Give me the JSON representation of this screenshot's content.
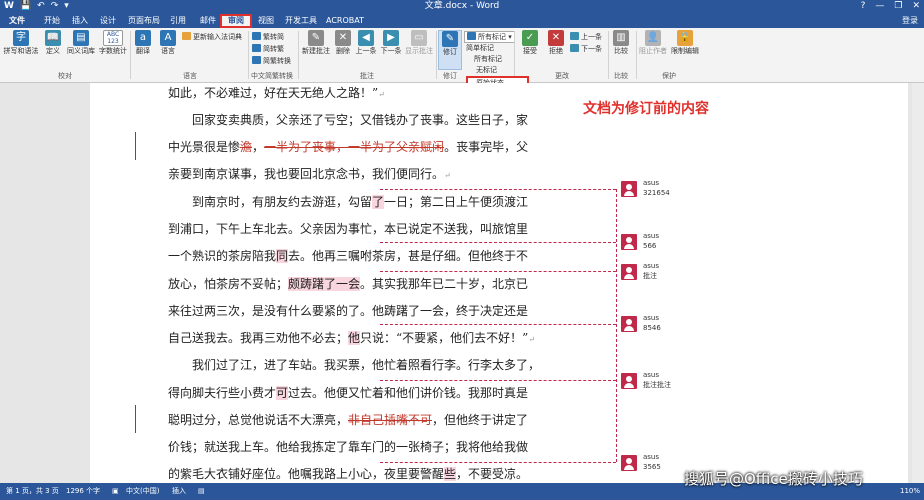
{
  "window": {
    "title": "文章.docx - Word",
    "login": "登录",
    "help": "?",
    "minimize": "—",
    "restore": "❐",
    "close": "✕"
  },
  "qat": {
    "save": "💾",
    "undo": "↶",
    "redo": "↷",
    "more": "▾"
  },
  "tabs": [
    {
      "label": "文件"
    },
    {
      "label": "开始"
    },
    {
      "label": "插入"
    },
    {
      "label": "设计"
    },
    {
      "label": "页面布局"
    },
    {
      "label": "引用"
    },
    {
      "label": "邮件"
    },
    {
      "label": "审阅"
    },
    {
      "label": "视图"
    },
    {
      "label": "开发工具"
    },
    {
      "label": "ACROBAT"
    }
  ],
  "ribbon": {
    "proofing": {
      "group": "校对",
      "spelling": "拼写和语法",
      "define": "定义",
      "thesaurus": "同义词库",
      "wordcount": "字数统计",
      "wordcount_icon": "ABC 123"
    },
    "language": {
      "group": "语言",
      "translate": "翻译",
      "language": "语言",
      "update_ime": "更新输入法词典"
    },
    "chinese": {
      "group": "中文简繁转换",
      "to_simplified": "繁转简",
      "to_traditional": "简转繁",
      "convert": "简繁转换"
    },
    "comments": {
      "group": "批注",
      "new": "新建批注",
      "delete": "删除",
      "previous": "上一条",
      "next": "下一条",
      "show": "显示批注"
    },
    "tracking": {
      "group": "修订",
      "track": "修订",
      "markup_all": "所有标记",
      "simple_markup": "简单标记",
      "all_markup": "所有标记",
      "no_markup": "无标记",
      "original": "原始状态",
      "pane_short": "修订"
    },
    "changes": {
      "group": "更改",
      "accept": "接受",
      "reject": "拒绝",
      "previous": "上一条",
      "next": "下一条"
    },
    "compare": {
      "group": "比较",
      "compare": "比较"
    },
    "protect": {
      "group": "保护",
      "block_authors": "阻止作者",
      "restrict": "限制编辑"
    }
  },
  "annotation": {
    "text": "文档为修订前的内容"
  },
  "document": {
    "lines": [
      {
        "segments": [
          {
            "t": "如此，不必难过，好在天无绝人之路！”",
            "k": "n"
          }
        ],
        "para_end": true
      },
      {
        "segments": [
          {
            "t": "　　回家变卖典质，父亲还了亏空；又借钱办了丧事。这些日子，家",
            "k": "n"
          }
        ]
      },
      {
        "segments": [
          {
            "t": "中光景很是惨",
            "k": "n"
          },
          {
            "t": "澹",
            "k": "d"
          },
          {
            "t": "，",
            "k": "n"
          },
          {
            "t": "一半为了丧事，一半为了父亲赋闲",
            "k": "d"
          },
          {
            "t": "。丧事完毕，父",
            "k": "n"
          }
        ]
      },
      {
        "segments": [
          {
            "t": "亲要到南京谋事，我也要回北京念书，我们便同行。",
            "k": "n"
          }
        ],
        "para_end": true
      },
      {
        "segments": [
          {
            "t": "　　到南京时，有朋友约去游逛，勾留",
            "k": "n"
          },
          {
            "t": "了",
            "k": "h"
          },
          {
            "t": "一日；第二日上午便须渡江",
            "k": "n"
          }
        ]
      },
      {
        "segments": [
          {
            "t": "到浦口，下午上车北去。父亲因为事忙，本已说定不送我，叫旅馆里",
            "k": "n"
          }
        ]
      },
      {
        "segments": [
          {
            "t": "一个熟识的茶房陪我",
            "k": "n"
          },
          {
            "t": "同",
            "k": "h"
          },
          {
            "t": "去。他再三嘱咐茶房，甚是仔细。但他终于不",
            "k": "n"
          }
        ]
      },
      {
        "segments": [
          {
            "t": "放心，怕茶房不妥帖；",
            "k": "n"
          },
          {
            "t": "颇踌躇了一会",
            "k": "h"
          },
          {
            "t": "。其实我那年已二十岁，北京已",
            "k": "n"
          }
        ]
      },
      {
        "segments": [
          {
            "t": "来往过两三次，是没有什么要紧的了。他踌躇了一会，终于决定还是",
            "k": "n"
          }
        ]
      },
      {
        "segments": [
          {
            "t": "自己送我去。我再三劝他不必去；",
            "k": "n"
          },
          {
            "t": "他",
            "k": "h"
          },
          {
            "t": "只说：“不要紧，他们去不好！”",
            "k": "n"
          }
        ],
        "para_end": true
      },
      {
        "segments": [
          {
            "t": "　　我们过了江，进了车站。我买票，他忙着照看行李。行李太多了，",
            "k": "n"
          }
        ]
      },
      {
        "segments": [
          {
            "t": "得向脚夫行些小费才",
            "k": "n"
          },
          {
            "t": "可",
            "k": "h"
          },
          {
            "t": "过去。他便又忙着和他们讲价钱。我那时真是",
            "k": "n"
          }
        ]
      },
      {
        "segments": [
          {
            "t": "聪明过分，总觉他说话不大漂亮，",
            "k": "n"
          },
          {
            "t": "非自己插嘴不可",
            "k": "d"
          },
          {
            "t": "，但他终于讲定了",
            "k": "n"
          }
        ]
      },
      {
        "segments": [
          {
            "t": "价钱；就送我上车。他给我拣定了靠车门的一张椅子；我将他给我做",
            "k": "n"
          }
        ]
      },
      {
        "segments": [
          {
            "t": "的紫毛大衣铺好座位。他嘱我路上小心，夜里要警醒",
            "k": "n"
          },
          {
            "t": "些",
            "k": "h"
          },
          {
            "t": "，不要受凉。",
            "k": "n"
          }
        ]
      }
    ]
  },
  "comments": [
    {
      "author": "asus",
      "text": "321654"
    },
    {
      "author": "asus",
      "text": "566"
    },
    {
      "author": "asus",
      "text": "批注"
    },
    {
      "author": "asus",
      "text": "8546"
    },
    {
      "author": "asus",
      "text": "批注批注"
    },
    {
      "author": "asus",
      "text": "3565"
    }
  ],
  "status": {
    "page": "第 1 页，共 3 页",
    "words": "1296 个字",
    "language": "中文(中国)",
    "mode": "插入",
    "zoom": "110%"
  },
  "watermark": "搜狐号@Office搬砖小技巧"
}
